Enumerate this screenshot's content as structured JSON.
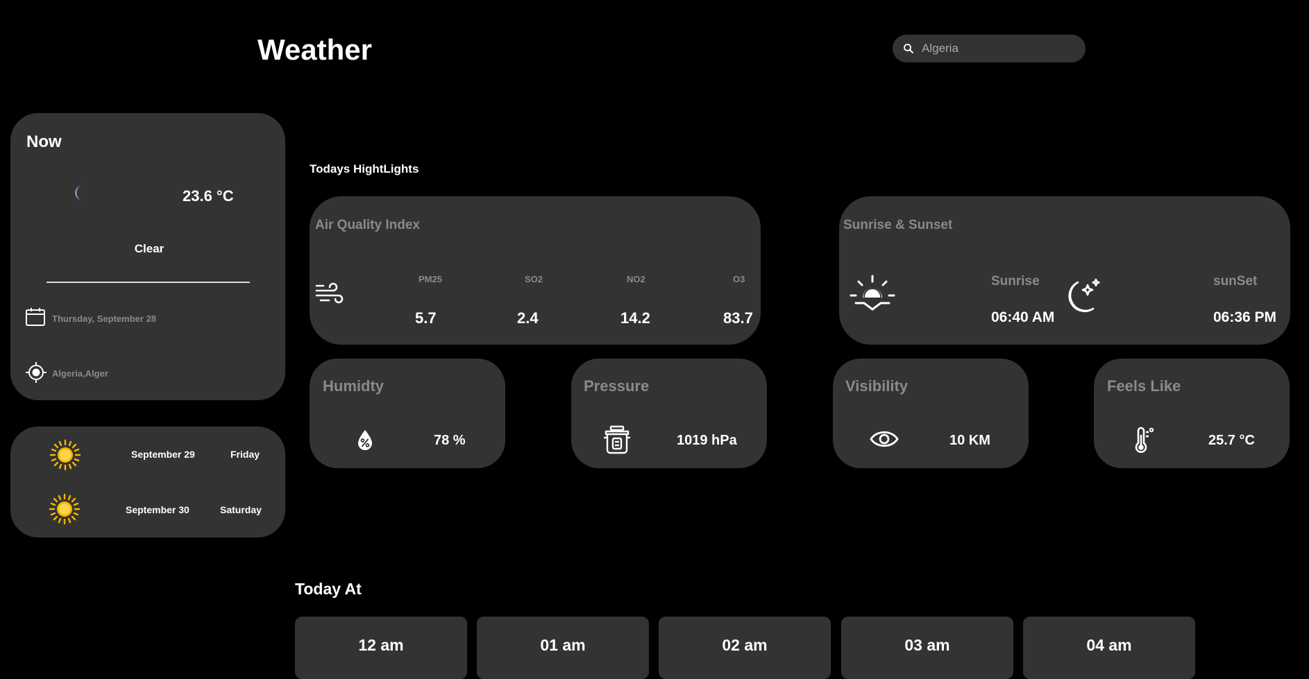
{
  "header": {
    "title": "Weather",
    "search": {
      "value": "Algeria",
      "icon": "search-icon"
    }
  },
  "now": {
    "heading": "Now",
    "temperature": "23.6 °C",
    "condition": "Clear",
    "condition_icon": "crescent-moon-icon",
    "date": "Thursday, September 28",
    "location": "Algeria,Alger"
  },
  "forecast": [
    {
      "date": "September 29",
      "day": "Friday",
      "icon": "sun-icon"
    },
    {
      "date": "September 30",
      "day": "Saturday",
      "icon": "sun-icon"
    }
  ],
  "highlights": {
    "heading": "Todays HightLights",
    "air_quality": {
      "title": "Air Quality Index",
      "items": [
        {
          "label": "PM25",
          "value": "5.7"
        },
        {
          "label": "SO2",
          "value": "2.4"
        },
        {
          "label": "NO2",
          "value": "14.2"
        },
        {
          "label": "O3",
          "value": "83.7"
        }
      ]
    },
    "sun": {
      "title": "Sunrise & Sunset",
      "sunrise_label": "Sunrise",
      "sunrise_time": "06:40 AM",
      "sunset_label": "sunSet",
      "sunset_time": "06:36 PM"
    },
    "humidity": {
      "title": "Humidty",
      "value": "78 %"
    },
    "pressure": {
      "title": "Pressure",
      "value": "1019 hPa"
    },
    "visibility": {
      "title": "Visibility",
      "value": "10 KM"
    },
    "feels_like": {
      "title": "Feels Like",
      "value": "25.7 °C"
    }
  },
  "today_at": {
    "heading": "Today At",
    "hours": [
      "12 am",
      "01 am",
      "02 am",
      "03 am",
      "04 am"
    ]
  },
  "colors": {
    "background": "#000000",
    "card": "#333333",
    "muted_text": "#8a8a8a",
    "sun": "#f5b800",
    "moon": "#1e78d6"
  }
}
